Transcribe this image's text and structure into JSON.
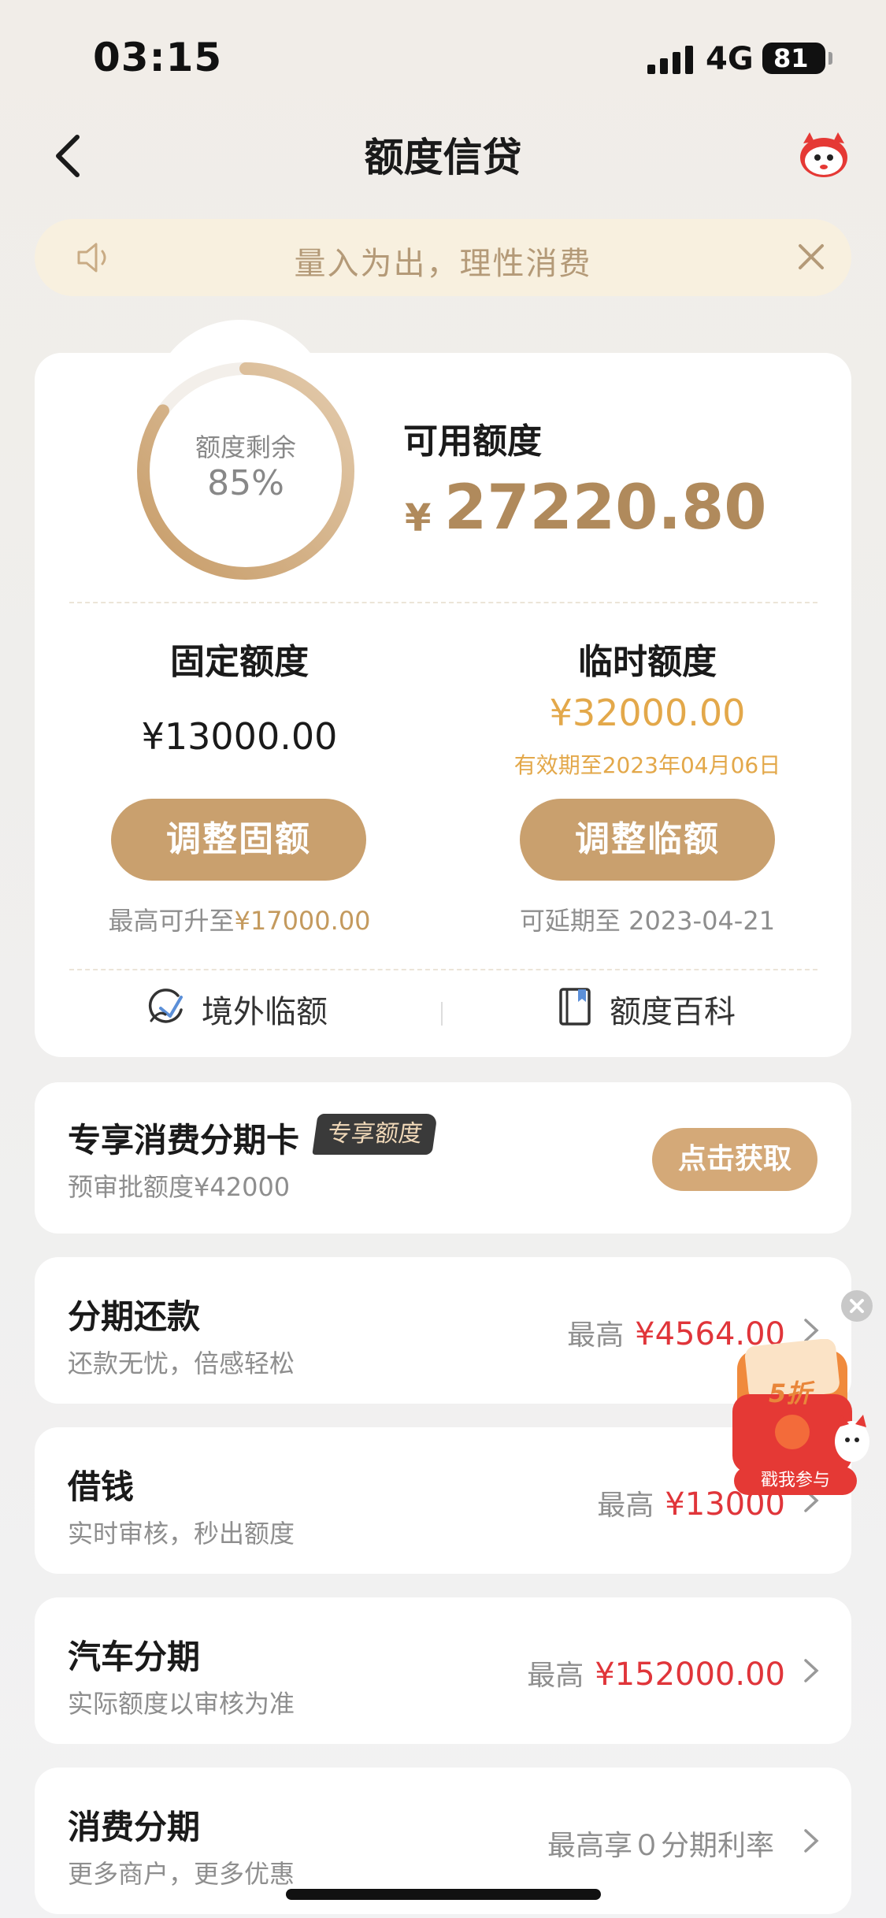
{
  "status_bar": {
    "time": "03:15",
    "network": "4G",
    "battery": "81"
  },
  "nav": {
    "title": "额度信贷"
  },
  "notice": {
    "text": "量入为出，理性消费"
  },
  "summary": {
    "ring_label": "额度剩余",
    "ring_percent": "85%",
    "ring_fraction": 0.85,
    "available_label": "可用额度",
    "available_currency": "¥",
    "available_amount": "27220.80"
  },
  "fixed": {
    "title": "固定额度",
    "amount": "¥13000.00",
    "button": "调整固额",
    "note_prefix": "最高可升至",
    "note_value": "¥17000.00"
  },
  "temporary": {
    "title": "临时额度",
    "amount": "¥32000.00",
    "expiry": "有效期至2023年04月06日",
    "button": "调整临额",
    "note": "可延期至 2023-04-21"
  },
  "links": {
    "overseas": "境外临额",
    "wiki": "额度百科"
  },
  "exclusive": {
    "title": "专享消费分期卡",
    "badge": "专享额度",
    "sub": "预审批额度¥42000",
    "button": "点击获取"
  },
  "rows": [
    {
      "title": "分期还款",
      "sub": "还款无忧，倍感轻松",
      "right_label": "最高",
      "right_value": "¥4564.00"
    },
    {
      "title": "借钱",
      "sub": "实时审核，秒出额度",
      "right_label": "最高",
      "right_value": "¥13000"
    },
    {
      "title": "汽车分期",
      "sub": "实际额度以审核为准",
      "right_label": "最高",
      "right_value": "¥152000.00"
    },
    {
      "title": "消费分期",
      "sub": "更多商户，更多优惠",
      "right_label": "最高享０分期利率",
      "right_value": ""
    }
  ],
  "promo": {
    "discount": "5折",
    "label": "戳我参与"
  },
  "colors": {
    "gold": "#c9a06e",
    "red": "#e0353a",
    "expiry_orange": "#e3a84a"
  }
}
